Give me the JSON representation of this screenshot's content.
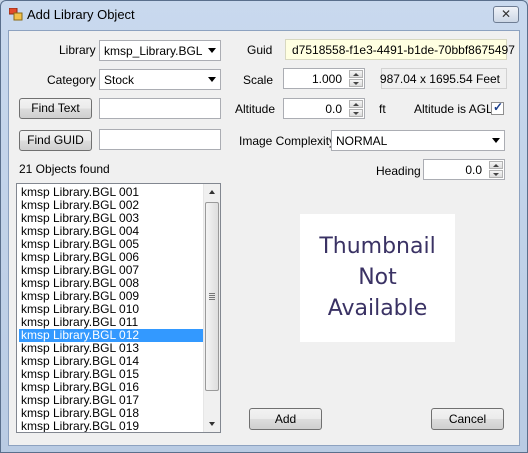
{
  "window": {
    "title": "Add Library Object",
    "close_symbol": "✕"
  },
  "form": {
    "library": {
      "label": "Library",
      "value": "kmsp_Library.BGL"
    },
    "category": {
      "label": "Category",
      "value": "Stock"
    },
    "find_text_button": "Find Text",
    "find_text_value": "",
    "find_guid_button": "Find GUID",
    "find_guid_value": "",
    "guid": {
      "label": "Guid",
      "value": "d7518558-f1e3-4491-b1de-70bbf8675497"
    },
    "scale": {
      "label": "Scale",
      "value": "1.000",
      "size_info": "987.04 x 1695.54 Feet"
    },
    "altitude": {
      "label": "Altitude",
      "value": "0.0",
      "unit": "ft",
      "agl_label": "Altitude is AGL",
      "agl_checked": true
    },
    "image_complexity": {
      "label": "Image Complexity",
      "value": "NORMAL"
    },
    "heading": {
      "label": "Heading",
      "value": "0.0"
    }
  },
  "results": {
    "count_text": "21 Objects found",
    "items": [
      "kmsp Library.BGL 001",
      "kmsp Library.BGL 002",
      "kmsp Library.BGL 003",
      "kmsp Library.BGL 004",
      "kmsp Library.BGL 005",
      "kmsp Library.BGL 006",
      "kmsp Library.BGL 007",
      "kmsp Library.BGL 008",
      "kmsp Library.BGL 009",
      "kmsp Library.BGL 010",
      "kmsp Library.BGL 011",
      "kmsp Library.BGL 012",
      "kmsp Library.BGL 013",
      "kmsp Library.BGL 014",
      "kmsp Library.BGL 015",
      "kmsp Library.BGL 016",
      "kmsp Library.BGL 017",
      "kmsp Library.BGL 018",
      "kmsp Library.BGL 019"
    ],
    "selected_index": 11
  },
  "thumbnail": {
    "line1": "Thumbnail",
    "line2": "Not",
    "line3": "Available"
  },
  "buttons": {
    "add": "Add",
    "cancel": "Cancel"
  }
}
